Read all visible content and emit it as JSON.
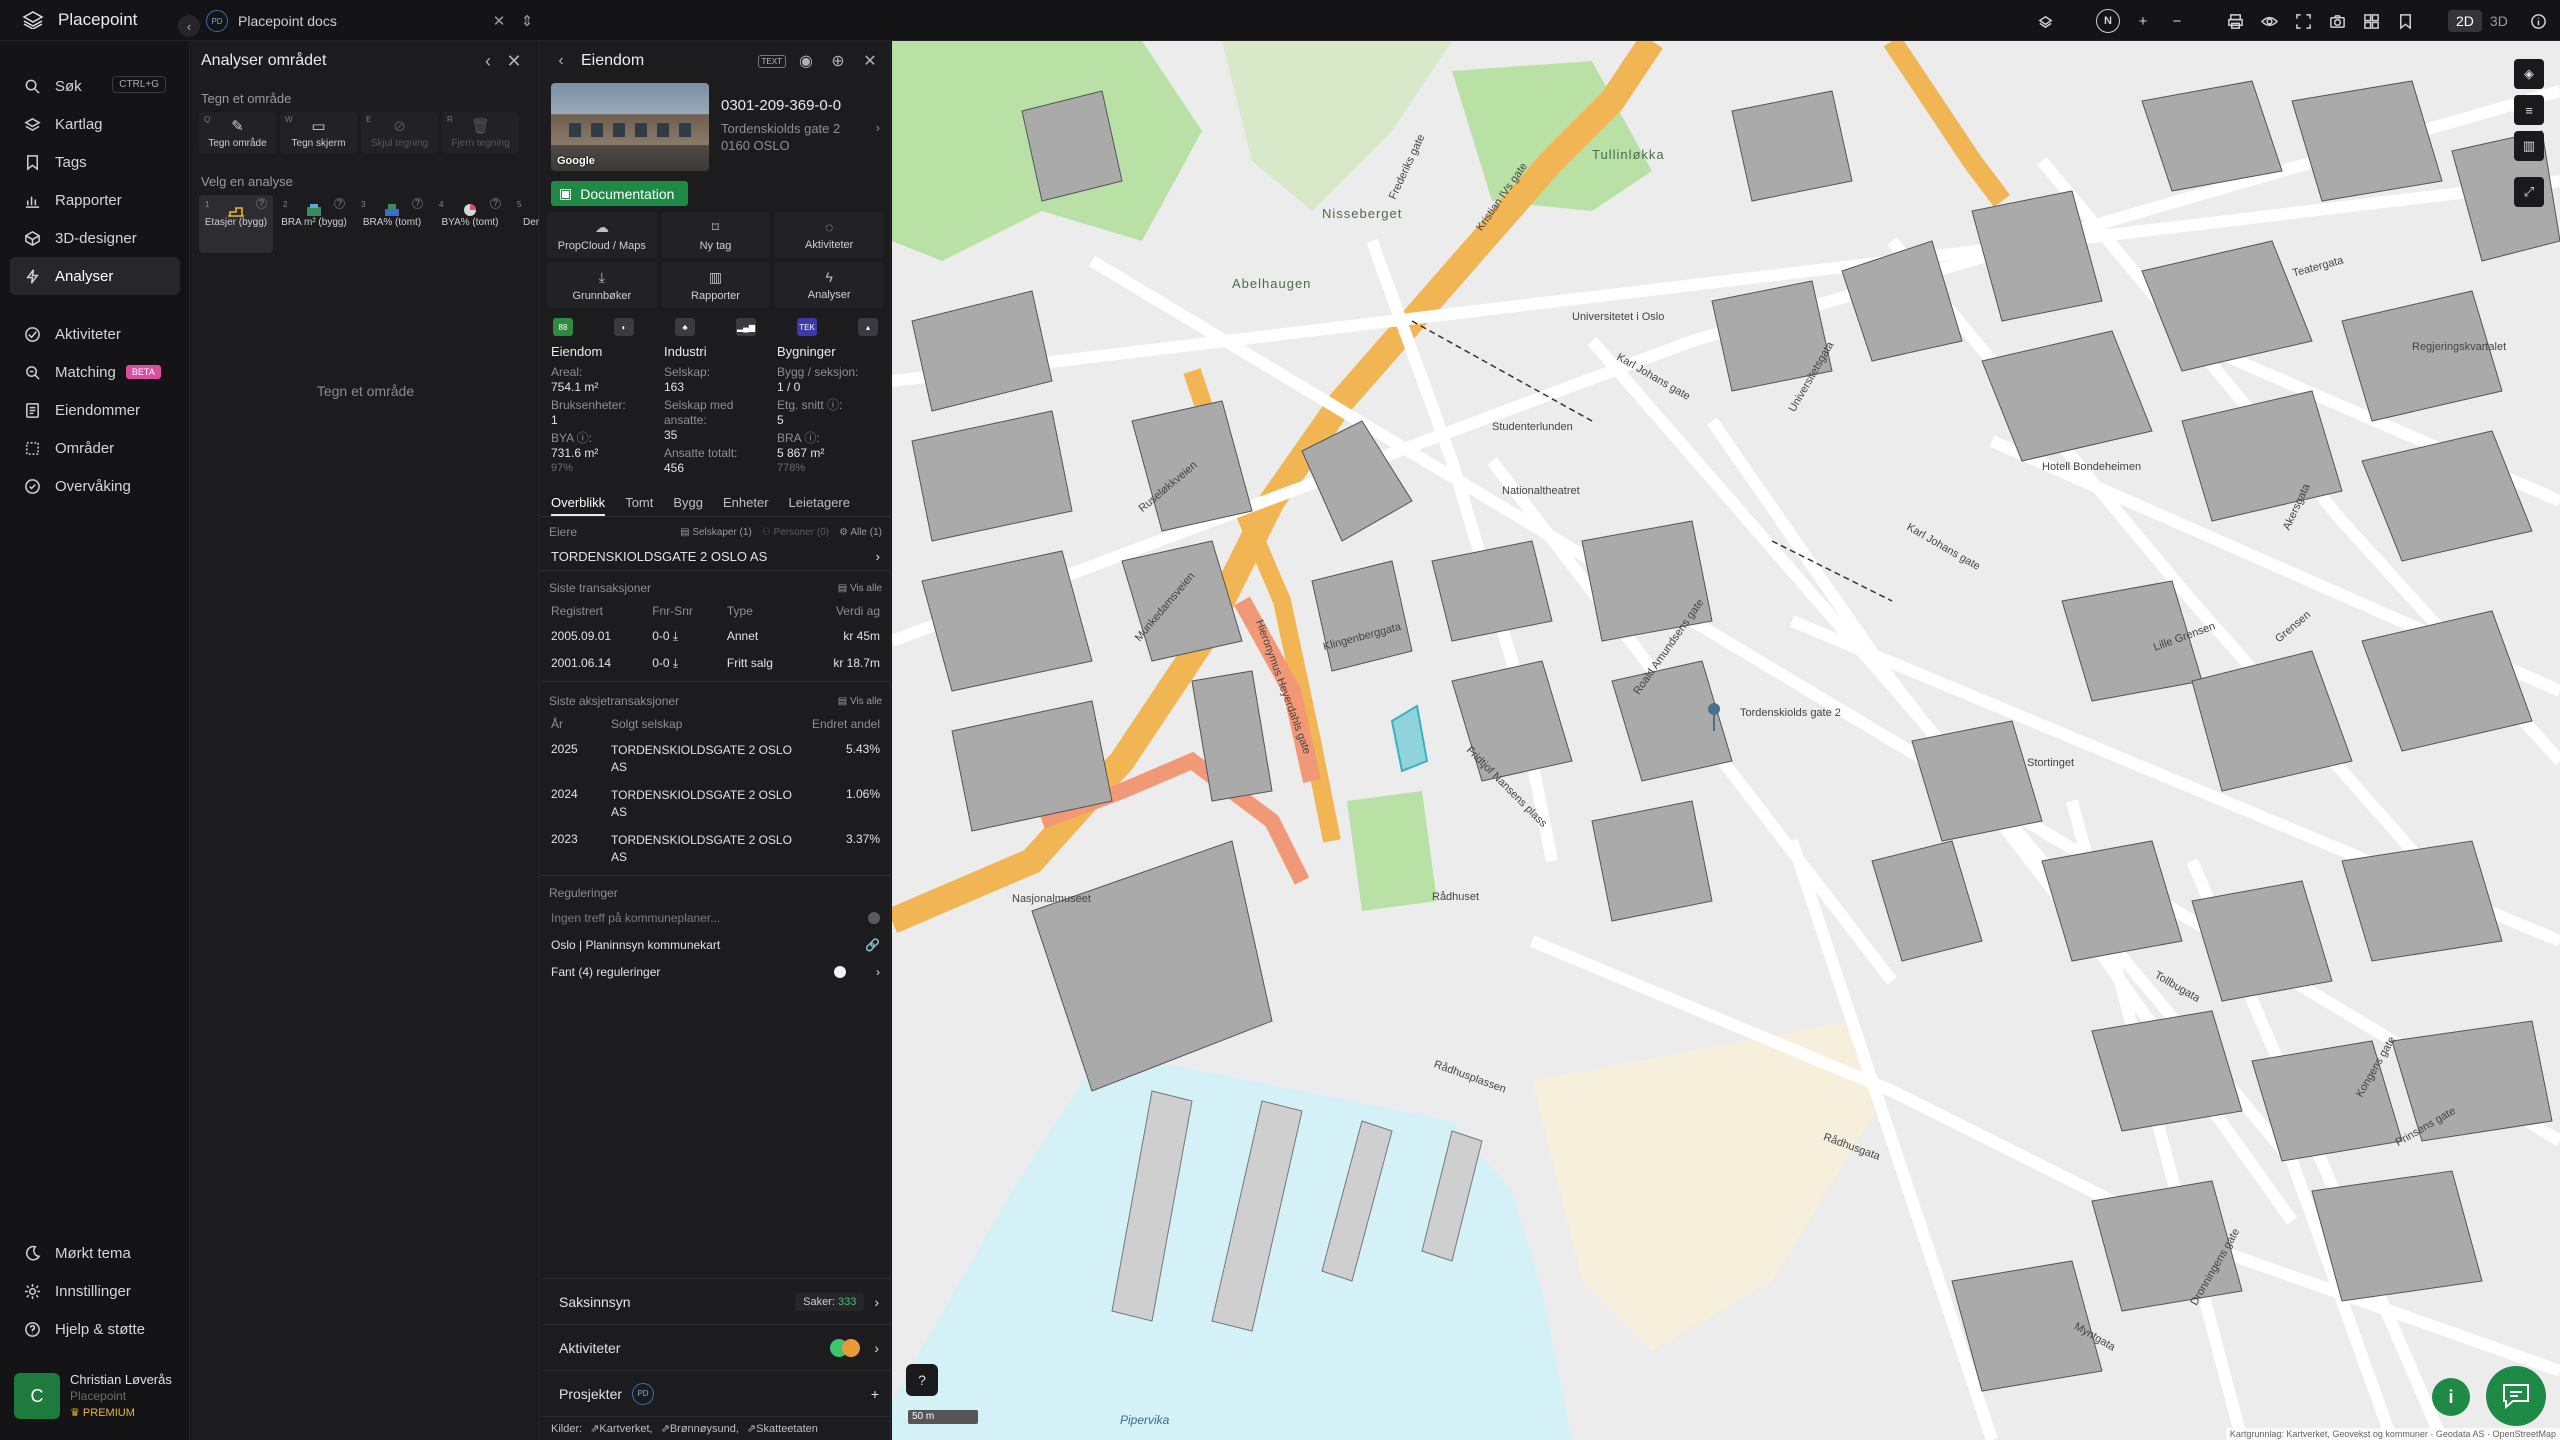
{
  "topbar": {
    "brand": "Placepoint",
    "docs_avatar": "PD",
    "docs_title": "Placepoint docs",
    "compass": "N",
    "view_2d": "2D",
    "view_3d": "3D"
  },
  "sidebar": {
    "items": [
      {
        "label": "Søk",
        "icon": "search-icon",
        "shortcut": "CTRL+G"
      },
      {
        "label": "Kartlag",
        "icon": "layers-icon"
      },
      {
        "label": "Tags",
        "icon": "bookmark-icon"
      },
      {
        "label": "Rapporter",
        "icon": "chart-icon"
      },
      {
        "label": "3D-designer",
        "icon": "cube-icon"
      },
      {
        "label": "Analyser",
        "icon": "bolt-icon",
        "active": true
      }
    ],
    "items2": [
      {
        "label": "Aktiviteter",
        "icon": "activity-icon"
      },
      {
        "label": "Matching",
        "icon": "target-icon",
        "badge": "BETA"
      },
      {
        "label": "Eiendommer",
        "icon": "list-icon"
      },
      {
        "label": "Områder",
        "icon": "area-icon"
      },
      {
        "label": "Overvåking",
        "icon": "watch-icon"
      }
    ],
    "bottom": [
      {
        "label": "Mørkt tema",
        "icon": "moon-icon"
      },
      {
        "label": "Innstillinger",
        "icon": "gear-icon"
      },
      {
        "label": "Hjelp & støtte",
        "icon": "help-icon"
      }
    ],
    "user": {
      "initial": "C",
      "name": "Christian Løverås",
      "org": "Placepoint",
      "plan": "PREMIUM"
    }
  },
  "analyse": {
    "title": "Analyser området",
    "draw_label": "Tegn et område",
    "draw_tools": [
      {
        "key": "Q",
        "label": "Tegn område",
        "glyph": "✎",
        "enabled": true
      },
      {
        "key": "W",
        "label": "Tegn skjerm",
        "glyph": "▭",
        "enabled": true
      },
      {
        "key": "E",
        "label": "Skjul tegning",
        "glyph": "⊘",
        "enabled": false
      },
      {
        "key": "R",
        "label": "Fjern tegning",
        "glyph": "🗑",
        "enabled": false
      }
    ],
    "select_label": "Velg en analyse",
    "analyses": [
      {
        "key": "1",
        "label": "Etasjer (bygg)",
        "active": true
      },
      {
        "key": "2",
        "label": "BRA m² (bygg)"
      },
      {
        "key": "3",
        "label": "BRA% (tomt)"
      },
      {
        "key": "4",
        "label": "BYA% (tomt)"
      },
      {
        "key": "5",
        "label": "Demo (omr"
      }
    ],
    "empty_hint": "Tegn et område"
  },
  "eiendom": {
    "title": "Eiendom",
    "id": "0301-209-369-0-0",
    "address1": "Tordenskiolds gate 2",
    "address2": "0160 OSLO",
    "streetview_logo": "Google",
    "doc_button": "Documentation",
    "actions": [
      {
        "label": "PropCloud / Maps",
        "glyph": "☁"
      },
      {
        "label": "Ny tag",
        "glyph": "⌑"
      },
      {
        "label": "Aktiviteter",
        "glyph": "◌"
      },
      {
        "label": "Grunnbøker",
        "glyph": "⤓"
      },
      {
        "label": "Rapporter",
        "glyph": "▥"
      },
      {
        "label": "Analyser",
        "glyph": "ϟ"
      }
    ],
    "kpi": {
      "eiendom": {
        "head": "Eiendom",
        "areal_l": "Areal:",
        "areal_v": "754.1 m²",
        "brukse_l": "Bruksenheter:",
        "brukse_v": "1",
        "bya_l": "BYA ⓘ:",
        "bya_v": "731.6 m²",
        "bya_s": "97%"
      },
      "industri": {
        "head": "Industri",
        "selskap_l": "Selskap:",
        "selskap_v": "163",
        "ansatte_l": "Selskap med ansatte:",
        "ansatte_v": "35",
        "tot_l": "Ansatte totalt:",
        "tot_v": "456"
      },
      "bygninger": {
        "head": "Bygninger",
        "bygg_l": "Bygg / seksjon:",
        "bygg_v": "1 / 0",
        "etg_l": "Etg. snitt ⓘ:",
        "etg_v": "5",
        "bra_l": "BRA ⓘ:",
        "bra_v": "5 867 m²",
        "bra_s": "778%"
      }
    },
    "tabs": [
      "Overblikk",
      "Tomt",
      "Bygg",
      "Enheter",
      "Leietagere"
    ],
    "owners": {
      "label": "Eiere",
      "selskaper": "Selskaper (1)",
      "personer": "Personer (0)",
      "alle": "Alle (1)",
      "name": "TORDENSKIOLDSGATE 2 OSLO AS"
    },
    "transactions": {
      "label": "Siste transaksjoner",
      "vis_alle": "Vis alle",
      "headers": [
        "Registrert",
        "Fnr-Snr",
        "Type",
        "Verdi ag"
      ],
      "rows": [
        {
          "date": "2005.09.01",
          "fnr": "0-0 ⤓",
          "type": "Annet",
          "value": "kr 45m"
        },
        {
          "date": "2001.06.14",
          "fnr": "0-0 ⤓",
          "type": "Fritt salg",
          "value": "kr 18.7m"
        }
      ]
    },
    "shares": {
      "label": "Siste aksjetransaksjoner",
      "vis_alle": "Vis alle",
      "headers": [
        "År",
        "Solgt selskap",
        "Endret andel"
      ],
      "rows": [
        {
          "year": "2025",
          "company": "TORDENSKIOLDSGATE 2 OSLO AS",
          "change": "5.43%"
        },
        {
          "year": "2024",
          "company": "TORDENSKIOLDSGATE 2 OSLO AS",
          "change": "1.06%"
        },
        {
          "year": "2023",
          "company": "TORDENSKIOLDSGATE 2 OSLO AS",
          "change": "3.37%"
        }
      ]
    },
    "reguleringer": {
      "label": "Reguleringer",
      "rows": [
        "Ingen treff på kommuneplaner...",
        "Oslo | Planinnsyn kommunekart",
        "Fant (4) reguleringer"
      ]
    },
    "bottom": {
      "saksinnsyn": "Saksinnsyn",
      "saker_label": "Saker:",
      "saker_count": "333",
      "aktiviteter": "Aktiviteter",
      "prosjekter": "Prosjekter",
      "prosjekter_badge": "PD",
      "kilder_label": "Kilder:",
      "kilder": [
        "Kartverket,",
        "Brønnøysund,",
        "Skatteetaten"
      ]
    }
  },
  "map": {
    "labels": {
      "tullinlokka": "Tullinløkka",
      "nisseberget": "Nisseberget",
      "abelhaugen": "Abelhaugen",
      "universitetet": "Universitetet i Oslo",
      "studenterlunden": "Studenterlunden",
      "nationaltheatret": "Nationaltheatret",
      "karl_johans": "Karl Johans gate",
      "karl_johans2": "Karl Johans gate",
      "stortinget": "Stortinget",
      "radhuset": "Rådhuset",
      "nasjonalmuseet": "Nasjonalmuseet",
      "radhusplassen": "Rådhusplassen",
      "radhusgata": "Rådhusgata",
      "pipervika": "Pipervika",
      "regjeringskvartalet": "Regjeringskvartalet",
      "munkedamsveien": "Munkedamsveien",
      "kristian_iv": "Kristian IVs gate",
      "hotel": "Hotell Bondeheimen",
      "teatergata": "Teatergata",
      "tordenskiolds": "Tordenskiolds gate 2",
      "frederiks": "Frederiks gate",
      "universitetsgata": "Universitetsgata",
      "roald_amundsens": "Roald Amundsens gate",
      "fridtjof": "Fridtjof Nansens plass",
      "ruseløkk": "Ruseløkkveien",
      "hieronymus": "Hieronymus Heyerdahls gate",
      "klingenberg": "Klingenberggata",
      "lille_grensen": "Lille Grensen",
      "grensen": "Grensen",
      "akersgata": "Akersgata",
      "kongens": "Kongens gate",
      "prinsens": "Prinsens gate",
      "tollbugata": "Tollbugata",
      "dronning": "Dronningens gate",
      "myntgata": "Myntgata"
    },
    "scale": "50 m",
    "attribution": "Kartgrunnlag: Kartverket, Geovekst og kommuner · Geodata AS · OpenStreetMap"
  }
}
